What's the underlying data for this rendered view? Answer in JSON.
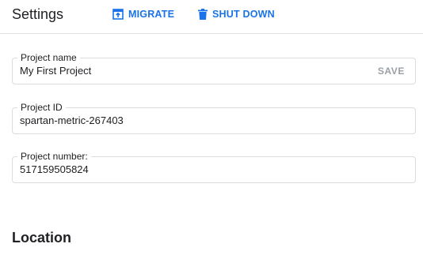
{
  "header": {
    "title": "Settings",
    "actions": [
      {
        "label": "MIGRATE",
        "icon": "migrate-icon"
      },
      {
        "label": "SHUT DOWN",
        "icon": "trash-icon"
      }
    ]
  },
  "fields": [
    {
      "label": "Project name",
      "value": "My First Project",
      "action": "SAVE"
    },
    {
      "label": "Project ID",
      "value": "spartan-metric-267403"
    },
    {
      "label": "Project number:",
      "value": "517159505824"
    }
  ],
  "sections": {
    "location_title": "Location"
  },
  "colors": {
    "accent": "#1a73e8",
    "border": "#dadce0",
    "disabled": "#9aa0a6"
  }
}
